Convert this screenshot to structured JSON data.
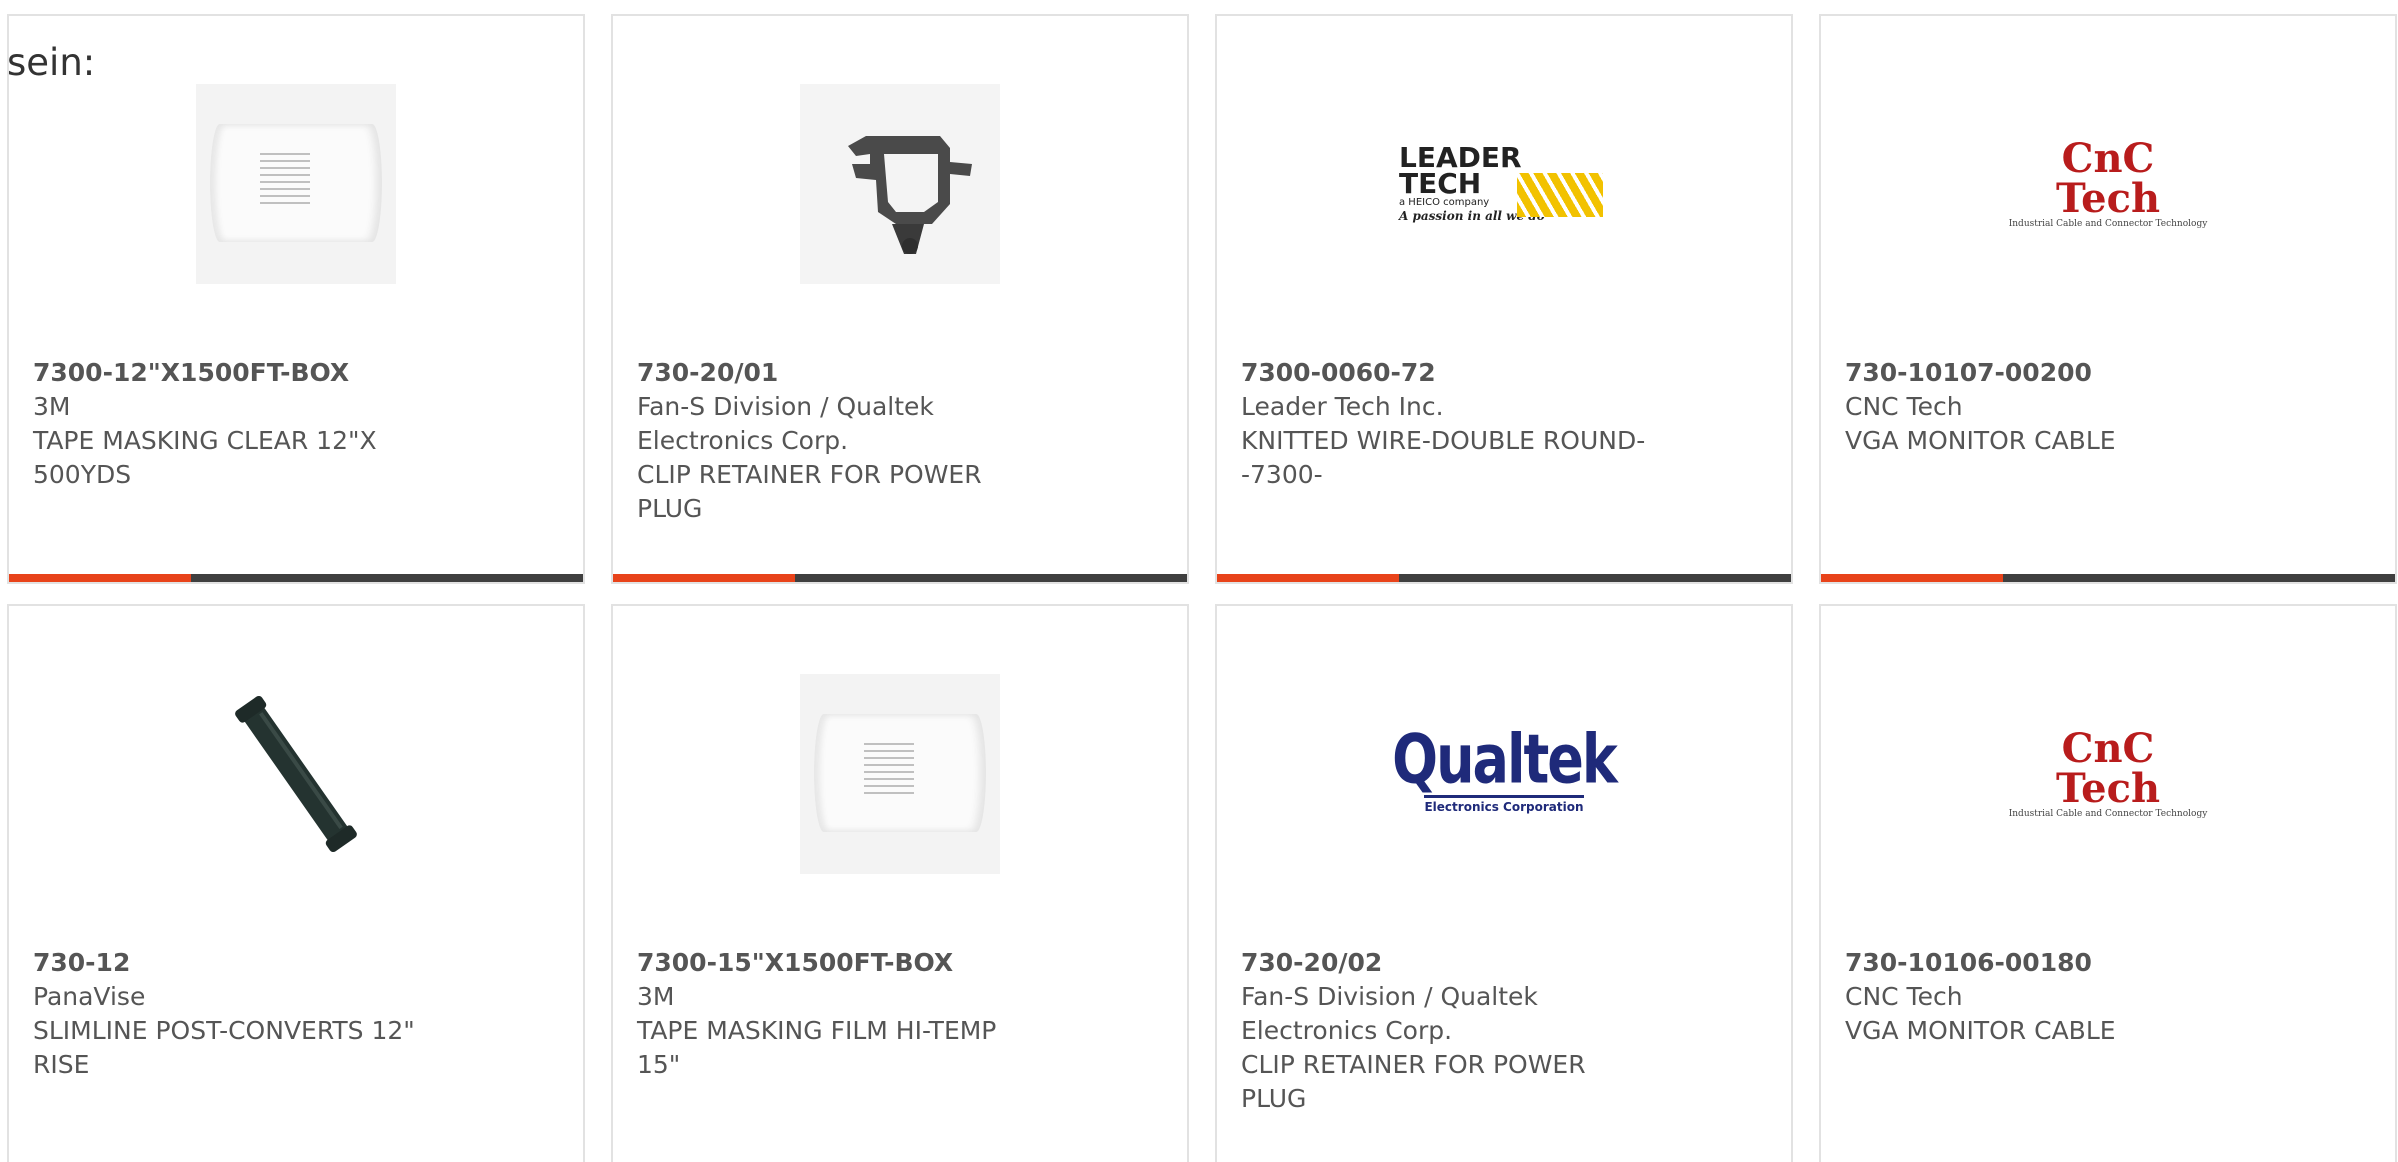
{
  "intro_text": "sein:",
  "colors": {
    "accent": "#e8431a",
    "bar": "#3f3f3f",
    "text": "#555555",
    "border": "#e2e2e2"
  },
  "products": [
    {
      "image": "tape-roll-image",
      "part_number": "7300-12\"X1500FT-BOX",
      "manufacturer": "3M",
      "description": "TAPE MASKING CLEAR 12\"X\n500YDS"
    },
    {
      "image": "clip-retainer-image",
      "part_number": "730-20/01",
      "manufacturer": "Fan-S Division / Qualtek\nElectronics Corp.",
      "description": "CLIP RETAINER FOR POWER\nPLUG"
    },
    {
      "image": "leader-tech-logo",
      "logo_text": {
        "line1": "LEADER",
        "line2": "TECH",
        "sub": "a HEICO company",
        "tag": "A passion in all we do"
      },
      "part_number": "7300-0060-72",
      "manufacturer": "Leader Tech Inc.",
      "description": "KNITTED WIRE-DOUBLE ROUND-\n-7300-"
    },
    {
      "image": "cnc-tech-logo",
      "logo_text": {
        "main": "CnC Tech",
        "sub": "Industrial Cable and Connector Technology"
      },
      "part_number": "730-10107-00200",
      "manufacturer": "CNC Tech",
      "description": "VGA MONITOR CABLE"
    },
    {
      "image": "post-tube-image",
      "part_number": "730-12",
      "manufacturer": "PanaVise",
      "description": "SLIMLINE POST-CONVERTS 12\"\nRISE"
    },
    {
      "image": "tape-roll-image",
      "part_number": "7300-15\"X1500FT-BOX",
      "manufacturer": "3M",
      "description": "TAPE MASKING FILM HI-TEMP\n15\""
    },
    {
      "image": "qualtek-logo",
      "logo_text": {
        "main": "Qualtek",
        "sub": "Electronics Corporation"
      },
      "part_number": "730-20/02",
      "manufacturer": "Fan-S Division / Qualtek\nElectronics Corp.",
      "description": "CLIP RETAINER FOR POWER\nPLUG"
    },
    {
      "image": "cnc-tech-logo",
      "logo_text": {
        "main": "CnC Tech",
        "sub": "Industrial Cable and Connector Technology"
      },
      "part_number": "730-10106-00180",
      "manufacturer": "CNC Tech",
      "description": "VGA MONITOR CABLE"
    }
  ]
}
